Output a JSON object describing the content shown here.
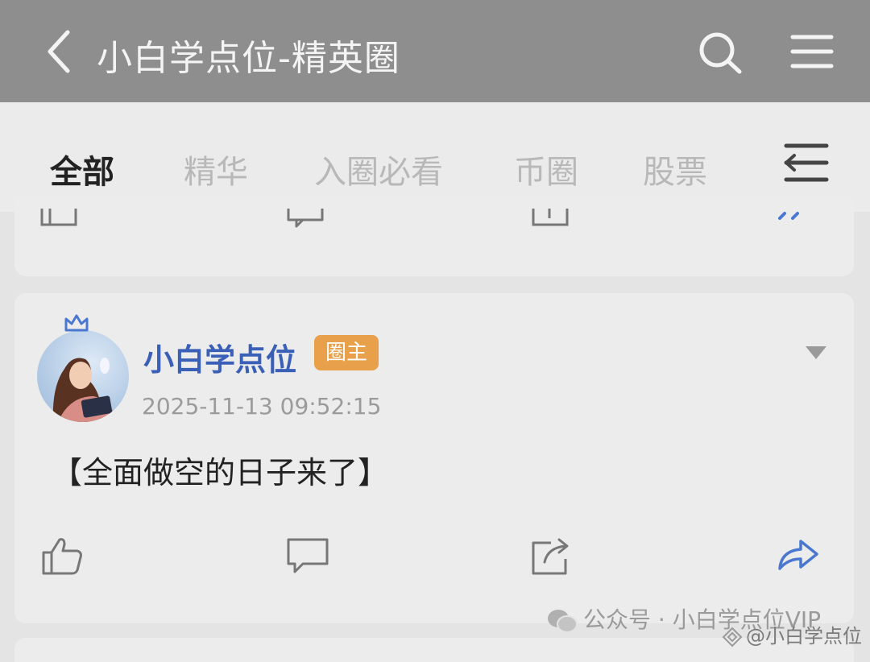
{
  "header": {
    "title": "小白学点位-精英圈",
    "back_icon": "chevron-left-icon",
    "search_icon": "search-icon",
    "menu_icon": "hamburger-menu-icon"
  },
  "tabs": [
    {
      "label": "全部",
      "active": true
    },
    {
      "label": "精华",
      "active": false
    },
    {
      "label": "入圈必看",
      "active": false
    },
    {
      "label": "币圈",
      "active": false
    },
    {
      "label": "股票",
      "active": false
    }
  ],
  "post": {
    "author": "小白学点位",
    "badge": "圈主",
    "time": "2025-11-13 09:52:15",
    "content": "【全面做空的日子来了】",
    "actions": [
      "like-icon",
      "comment-icon",
      "share-icon",
      "forward-icon"
    ]
  },
  "watermark": {
    "line1": "公众号 · 小白学点位VIP",
    "line2": "@小白学点位"
  },
  "colors": {
    "topbar": "#8e8e8e",
    "accent": "#3f6fd6",
    "author_name": "#3a5fb6",
    "badge": "#e8a14a",
    "forward_icon": "#4a78d0"
  }
}
